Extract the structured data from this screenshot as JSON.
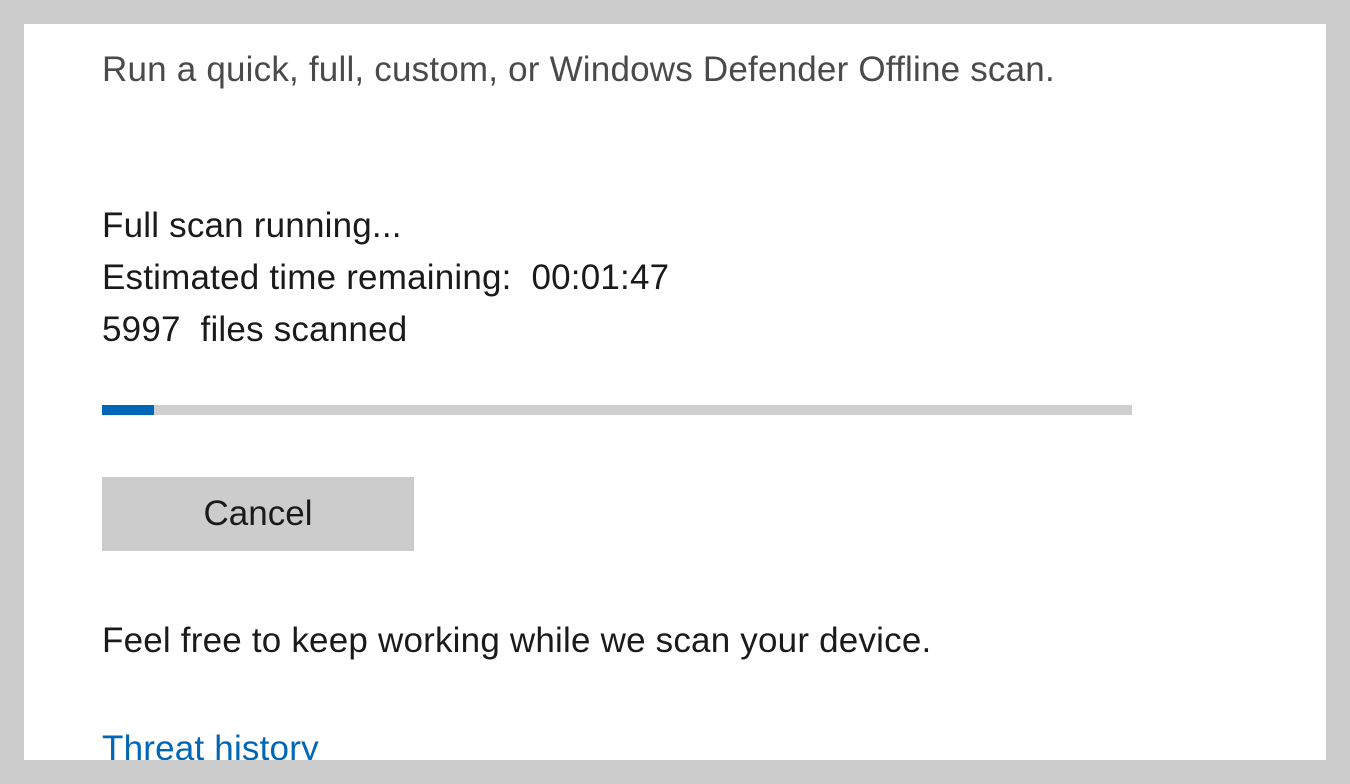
{
  "header": {
    "subtitle": "Run a quick, full, custom, or Windows Defender Offline scan."
  },
  "scan": {
    "status_line": "Full scan running...",
    "eta_label": "Estimated time remaining:",
    "eta_value": "00:01:47",
    "files_count": "5997",
    "files_label": "files scanned",
    "progress_percent": 5,
    "cancel_label": "Cancel"
  },
  "footer": {
    "info_text": "Feel free to keep working while we scan your device.",
    "link_label": "Threat history"
  },
  "colors": {
    "accent": "#0067b8",
    "button_bg": "#cccccc",
    "progress_track": "#cfcfcf",
    "page_bg": "#cccccc"
  }
}
